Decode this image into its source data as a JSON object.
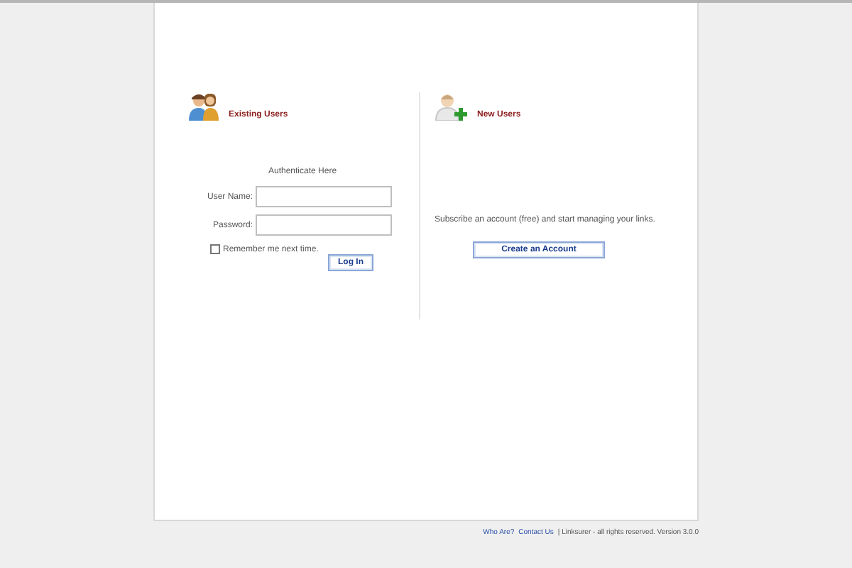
{
  "existing": {
    "title": "Existing Users",
    "heading": "Authenticate Here",
    "fields": [
      {
        "label": "User Name:"
      },
      {
        "label": "Password:"
      }
    ],
    "remember": {
      "label": "Remember me next time.",
      "checked": false
    },
    "button": "Log In"
  },
  "new": {
    "title": "New Users",
    "text": "Subscribe an account (free) and start managing your links.",
    "button": "Create an Account"
  },
  "footer": {
    "links": [
      "Who Are?",
      "Contact Us"
    ],
    "text": "| Linksurer - all rights reserved. Version 3.0.0"
  }
}
